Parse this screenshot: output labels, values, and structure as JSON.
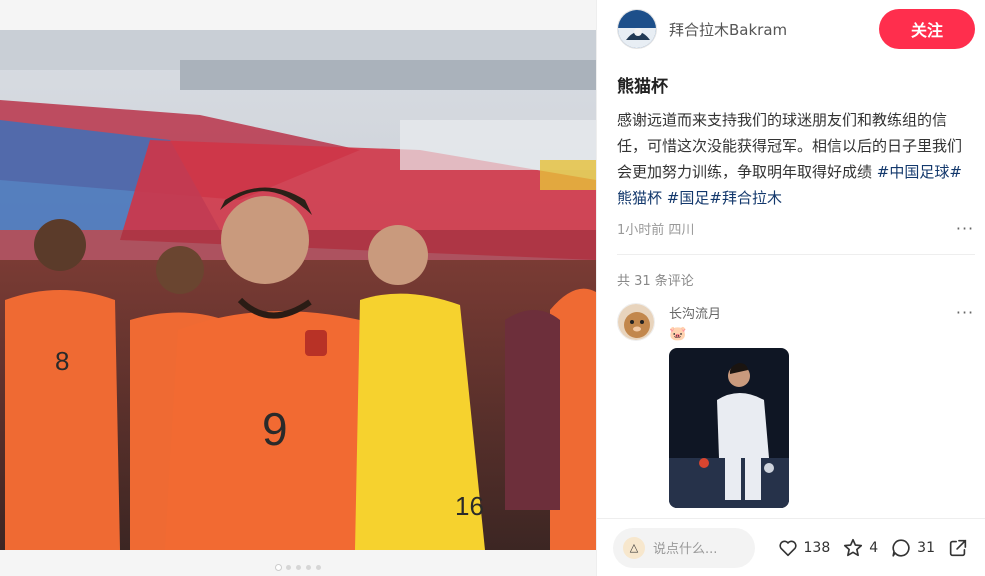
{
  "author": {
    "name": "拜合拉木Bakram",
    "follow_label": "关注"
  },
  "note": {
    "title": "熊猫杯",
    "description": "感谢远道而来支持我们的球迷朋友们和教练组的信任，可惜这次没能获得冠军。相信以后的日子里我们会更加努力训练，争取明年取得好成绩",
    "tags": [
      "#中国足球",
      "#熊猫杯",
      "#国足",
      "#拜合拉木"
    ],
    "time": "1小时前",
    "location": "四川"
  },
  "comments": {
    "count_label": "共 31 条评论",
    "items": [
      {
        "user": "长沟流月",
        "emoji": "🐷"
      }
    ]
  },
  "carousel": {
    "total": 5,
    "active": 1
  },
  "bottom_bar": {
    "reply_placeholder": "说点什么...",
    "likes": "138",
    "collects": "4",
    "comments": "31"
  },
  "colors": {
    "accent": "#ff2e4d",
    "tag": "#13386c",
    "jersey": "#f26a32",
    "keeper": "#f6d22e"
  },
  "icons": [
    "heart-icon",
    "star-icon",
    "comment-icon",
    "share-icon",
    "more-icon"
  ]
}
